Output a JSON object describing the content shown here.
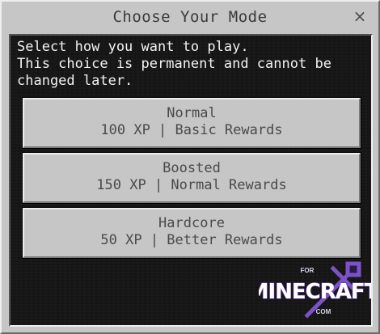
{
  "dialog": {
    "title": "Choose Your Mode",
    "close_glyph": "×",
    "close_icon": "close-icon",
    "description_lines": [
      "Select how you want to play.",
      "This choice is permanent and cannot be",
      "changed later."
    ]
  },
  "options": [
    {
      "name": "Normal",
      "details": "100 XP | Basic Rewards"
    },
    {
      "name": "Boosted",
      "details": "150 XP | Normal Rewards"
    },
    {
      "name": "Hardcore",
      "details": "50 XP | Better Rewards"
    }
  ],
  "watermark": {
    "top": "FOR",
    "main": "MINECRAFT",
    "bottom": "COM"
  },
  "colors": {
    "dialog_bg": "#c6c6c6",
    "panel_bg": "#141414",
    "button_bg": "#c6c6c6",
    "button_text": "#4a4a4a",
    "watermark": "#7c52c9"
  }
}
